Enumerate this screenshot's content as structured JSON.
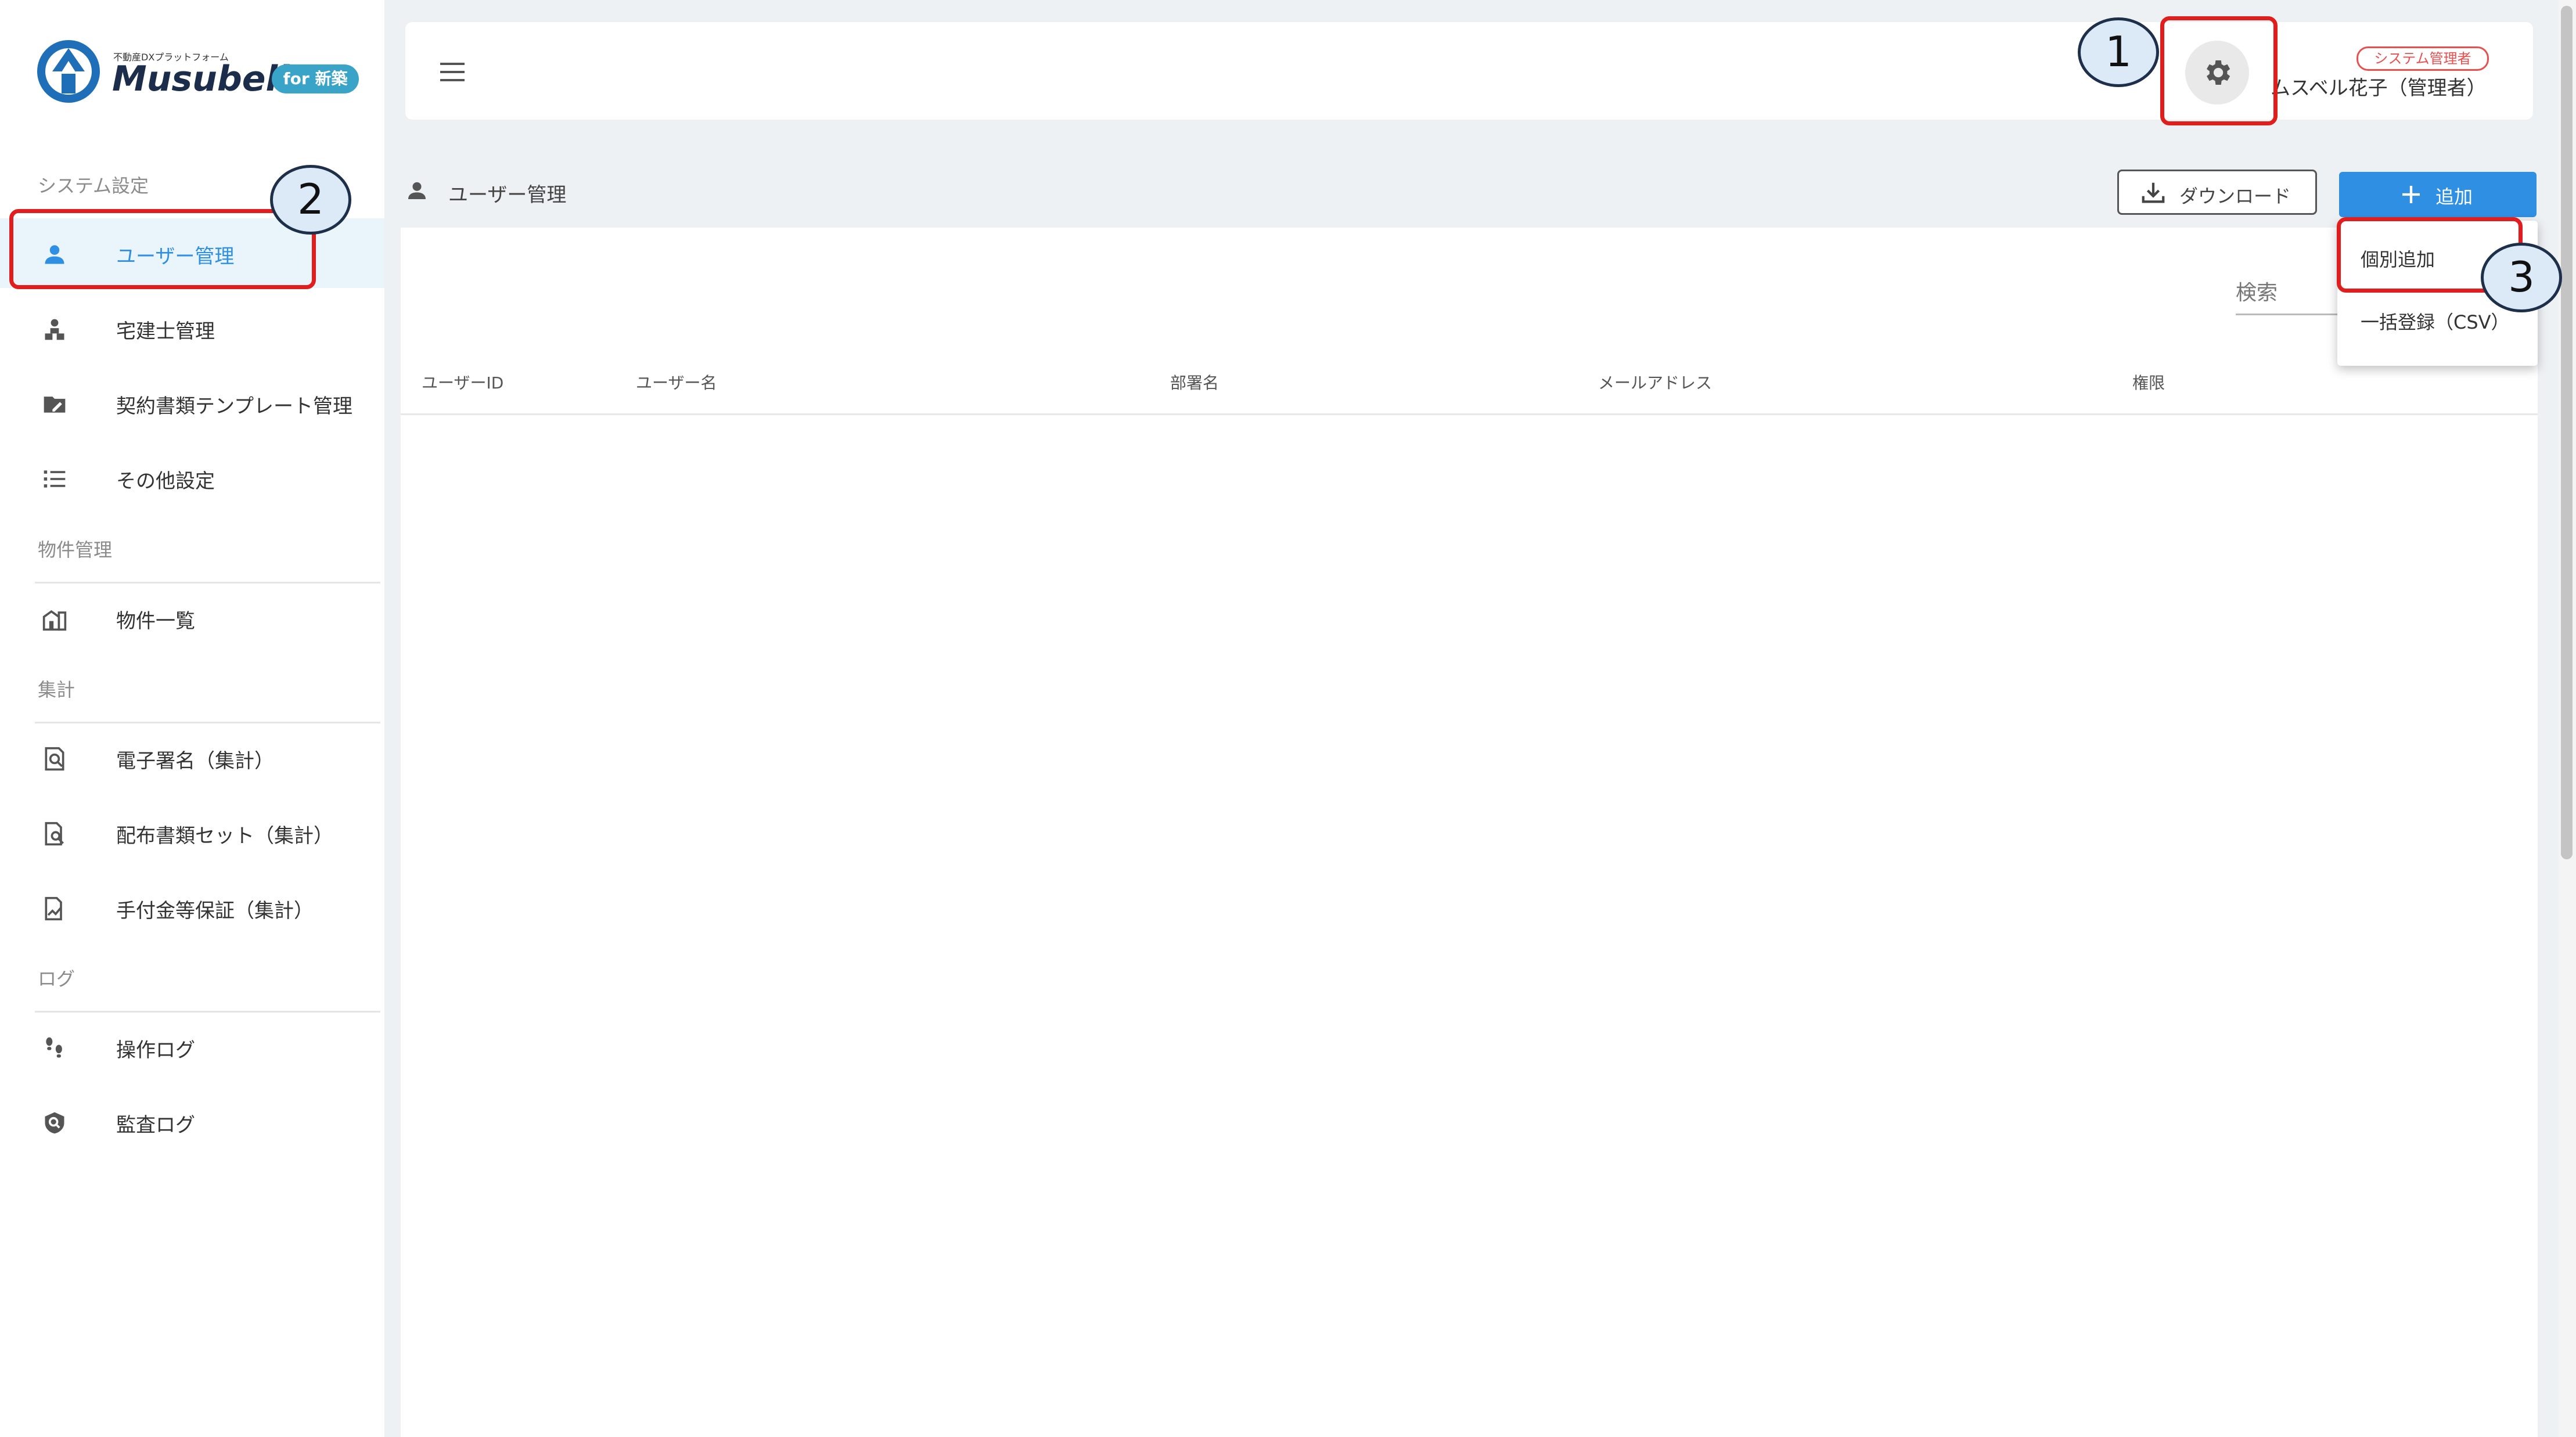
{
  "logo": {
    "subtitle": "不動産DXプラットフォーム",
    "name": "Musubell",
    "tag": "for 新築"
  },
  "sidebar": {
    "sections": [
      {
        "label": "システム設定",
        "items": [
          {
            "label": "ユーザー管理",
            "icon": "person-icon",
            "active": true
          },
          {
            "label": "宅建士管理",
            "icon": "agent-icon"
          },
          {
            "label": "契約書類テンプレート管理",
            "icon": "folder-edit-icon"
          },
          {
            "label": "その他設定",
            "icon": "list-icon"
          }
        ]
      },
      {
        "label": "物件管理",
        "items": [
          {
            "label": "物件一覧",
            "icon": "building-icon"
          }
        ]
      },
      {
        "label": "集計",
        "items": [
          {
            "label": "電子署名（集計）",
            "icon": "doc-search-icon"
          },
          {
            "label": "配布書類セット（集計）",
            "icon": "doc-magnify-icon"
          },
          {
            "label": "手付金等保証（集計）",
            "icon": "doc-chart-icon"
          }
        ]
      },
      {
        "label": "ログ",
        "items": [
          {
            "label": "操作ログ",
            "icon": "footsteps-icon"
          },
          {
            "label": "監査ログ",
            "icon": "shield-search-icon"
          }
        ]
      }
    ]
  },
  "header": {
    "role_badge": "システム管理者",
    "user_name": "ムスベル花子（管理者）"
  },
  "page": {
    "title": "ユーザー管理",
    "download_label": "ダウンロード",
    "add_label": "追加",
    "search_label": "検索"
  },
  "table": {
    "columns": [
      "ユーザーID",
      "ユーザー名",
      "部署名",
      "メールアドレス",
      "権限"
    ]
  },
  "add_menu": {
    "items": [
      "個別追加",
      "一括登録（CSV）"
    ]
  },
  "annotations": {
    "callouts": [
      "1",
      "2",
      "3"
    ],
    "highlight_color": "#e01e1e"
  },
  "colors": {
    "accent": "#2f8fe3",
    "badge": "#e8504f",
    "active_bg": "#eaf4fb"
  }
}
